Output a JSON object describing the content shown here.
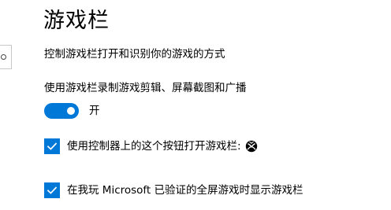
{
  "page": {
    "title": "游戏栏",
    "description": "控制游戏栏打开和识别你的游戏的方式"
  },
  "record_setting": {
    "label": "使用游戏栏录制游戏剪辑、屏幕截图和广播",
    "toggle_state_label": "开",
    "toggle_on": true
  },
  "checkboxes": [
    {
      "label": "使用控制器上的这个按钮打开游戏栏:",
      "checked": true,
      "trailing_icon": "xbox-icon"
    },
    {
      "label": "在我玩 Microsoft 已验证的全屏游戏时显示游戏栏",
      "checked": true
    }
  ],
  "colors": {
    "accent": "#0078d7",
    "text": "#000000",
    "background": "#ffffff"
  }
}
